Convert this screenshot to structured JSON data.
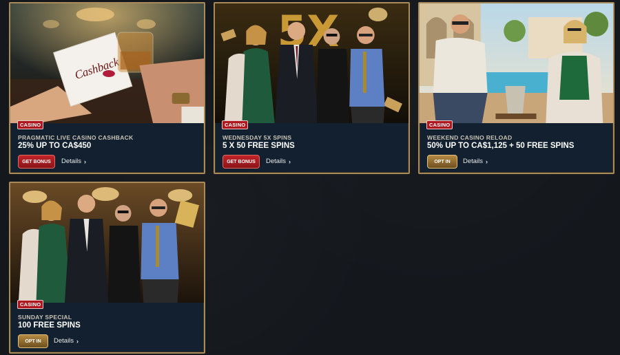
{
  "cards": [
    {
      "tag": "CASINO",
      "title": "PRAGMATIC LIVE CASINO CASHBACK",
      "subtitle": "25% UP TO CA$450",
      "button": "GET BONUS",
      "details": "Details",
      "image_text": "Cashback"
    },
    {
      "tag": "CASINO",
      "title": "WEDNESDAY 5X SPINS",
      "subtitle": "5 X 50 FREE SPINS",
      "button": "GET BONUS",
      "details": "Details",
      "image_text": "5X"
    },
    {
      "tag": "CASINO",
      "title": "WEEKEND CASINO RELOAD",
      "subtitle": "50% UP TO CA$1,125 + 50 FREE SPINS",
      "button": "OPT IN",
      "details": "Details"
    },
    {
      "tag": "CASINO",
      "title": "SUNDAY SPECIAL",
      "subtitle": "100 FREE SPINS",
      "button": "OPT IN",
      "details": "Details"
    }
  ],
  "colors": {
    "border_gold": "#a98a5a",
    "card_bg": "#12202f",
    "tag_red": "#b0161e",
    "button_red": "#c0262a",
    "button_gold": "#b58a42"
  },
  "icons": {
    "details_chevron": "chevron-right-icon"
  }
}
